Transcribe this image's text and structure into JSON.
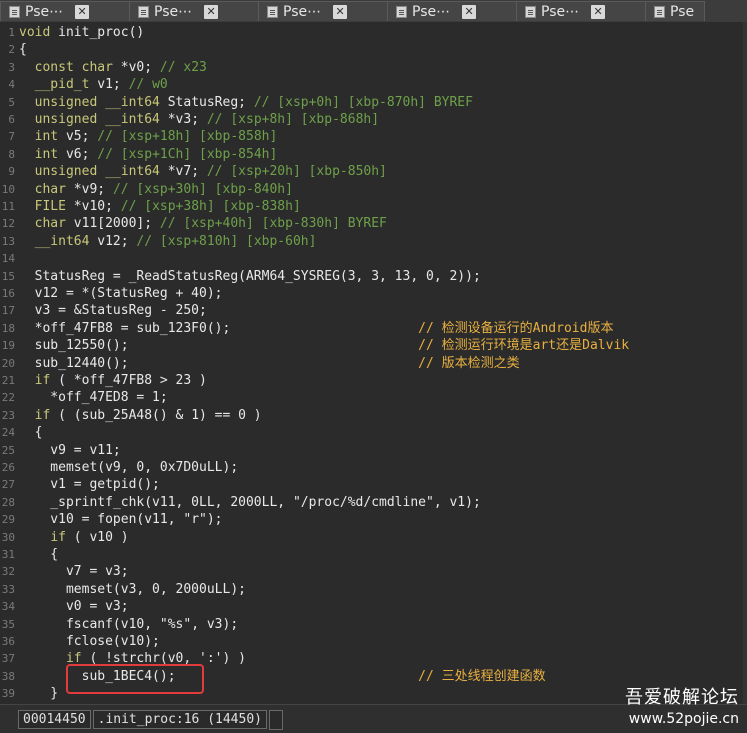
{
  "tabs": [
    {
      "label": "Pse⋯"
    },
    {
      "label": "Pse⋯"
    },
    {
      "label": "Pse⋯"
    },
    {
      "label": "Pse⋯"
    },
    {
      "label": "Pse⋯"
    },
    {
      "label": "Pse"
    }
  ],
  "code_lines": [
    {
      "n": "1",
      "segs": [
        [
          "kw",
          "void "
        ],
        [
          "fn",
          "init_proc()"
        ]
      ]
    },
    {
      "n": "2",
      "segs": [
        [
          "",
          "{"
        ]
      ]
    },
    {
      "n": "3",
      "segs": [
        [
          "",
          "  "
        ],
        [
          "kw",
          "const char "
        ],
        [
          "",
          "*v0; "
        ],
        [
          "cm",
          "// x23"
        ]
      ]
    },
    {
      "n": "4",
      "segs": [
        [
          "",
          "  "
        ],
        [
          "kw",
          "__pid_t "
        ],
        [
          "",
          "v1; "
        ],
        [
          "cm",
          "// w0"
        ]
      ]
    },
    {
      "n": "5",
      "segs": [
        [
          "",
          "  "
        ],
        [
          "kw",
          "unsigned __int64 "
        ],
        [
          "",
          "StatusReg; "
        ],
        [
          "cm",
          "// [xsp+0h] [xbp-870h] BYREF"
        ]
      ]
    },
    {
      "n": "6",
      "segs": [
        [
          "",
          "  "
        ],
        [
          "kw",
          "unsigned __int64 "
        ],
        [
          "",
          "*v3; "
        ],
        [
          "cm",
          "// [xsp+8h] [xbp-868h]"
        ]
      ]
    },
    {
      "n": "7",
      "segs": [
        [
          "",
          "  "
        ],
        [
          "kw",
          "int "
        ],
        [
          "",
          "v5; "
        ],
        [
          "cm",
          "// [xsp+18h] [xbp-858h]"
        ]
      ]
    },
    {
      "n": "8",
      "segs": [
        [
          "",
          "  "
        ],
        [
          "kw",
          "int "
        ],
        [
          "",
          "v6; "
        ],
        [
          "cm",
          "// [xsp+1Ch] [xbp-854h]"
        ]
      ]
    },
    {
      "n": "9",
      "segs": [
        [
          "",
          "  "
        ],
        [
          "kw",
          "unsigned __int64 "
        ],
        [
          "",
          "*v7; "
        ],
        [
          "cm",
          "// [xsp+20h] [xbp-850h]"
        ]
      ]
    },
    {
      "n": "10",
      "segs": [
        [
          "",
          "  "
        ],
        [
          "kw",
          "char "
        ],
        [
          "",
          "*v9; "
        ],
        [
          "cm",
          "// [xsp+30h] [xbp-840h]"
        ]
      ]
    },
    {
      "n": "11",
      "segs": [
        [
          "",
          "  "
        ],
        [
          "kw",
          "FILE "
        ],
        [
          "",
          "*v10; "
        ],
        [
          "cm",
          "// [xsp+38h] [xbp-838h]"
        ]
      ]
    },
    {
      "n": "12",
      "segs": [
        [
          "",
          "  "
        ],
        [
          "kw",
          "char "
        ],
        [
          "",
          "v11[2000]; "
        ],
        [
          "cm",
          "// [xsp+40h] [xbp-830h] BYREF"
        ]
      ]
    },
    {
      "n": "13",
      "segs": [
        [
          "",
          "  "
        ],
        [
          "kw",
          "__int64 "
        ],
        [
          "",
          "v12; "
        ],
        [
          "cm",
          "// [xsp+810h] [xbp-60h]"
        ]
      ]
    },
    {
      "n": "14",
      "segs": [
        [
          "",
          ""
        ]
      ]
    },
    {
      "n": "15",
      "segs": [
        [
          "",
          "  StatusReg = _ReadStatusReg(ARM64_SYSREG(3, 3, 13, 0, 2));"
        ]
      ]
    },
    {
      "n": "16",
      "segs": [
        [
          "",
          "  v12 = *(StatusReg + 40);"
        ]
      ]
    },
    {
      "n": "17",
      "segs": [
        [
          "",
          "  v3 = &StatusReg - 250;"
        ]
      ]
    },
    {
      "n": "18",
      "segs": [
        [
          "",
          "  *off_47FB8 = sub_123F0();                        "
        ],
        [
          "ann",
          "// 检测设备运行的Android版本"
        ]
      ]
    },
    {
      "n": "19",
      "segs": [
        [
          "",
          "  sub_12550();                                     "
        ],
        [
          "ann",
          "// 检测运行环境是art还是Dalvik"
        ]
      ]
    },
    {
      "n": "20",
      "segs": [
        [
          "",
          "  sub_12440();                                     "
        ],
        [
          "ann",
          "// 版本检测之类"
        ]
      ]
    },
    {
      "n": "21",
      "segs": [
        [
          "",
          "  "
        ],
        [
          "kw",
          "if "
        ],
        [
          "",
          "( *off_47FB8 > 23 )"
        ]
      ]
    },
    {
      "n": "22",
      "segs": [
        [
          "",
          "    *off_47ED8 = 1;"
        ]
      ]
    },
    {
      "n": "23",
      "segs": [
        [
          "",
          "  "
        ],
        [
          "kw",
          "if "
        ],
        [
          "",
          "( (sub_25A48() & 1) == 0 )"
        ]
      ]
    },
    {
      "n": "24",
      "segs": [
        [
          "",
          "  {"
        ]
      ]
    },
    {
      "n": "25",
      "segs": [
        [
          "",
          "    v9 = v11;"
        ]
      ]
    },
    {
      "n": "26",
      "segs": [
        [
          "",
          "    memset(v9, 0, 0x7D0uLL);"
        ]
      ]
    },
    {
      "n": "27",
      "segs": [
        [
          "",
          "    v1 = getpid();"
        ]
      ]
    },
    {
      "n": "28",
      "segs": [
        [
          "",
          "    _sprintf_chk(v11, 0LL, 2000LL, "
        ],
        [
          "str",
          "\"/proc/%d/cmdline\""
        ],
        [
          "",
          ", v1);"
        ]
      ]
    },
    {
      "n": "29",
      "segs": [
        [
          "",
          "    v10 = fopen(v11, "
        ],
        [
          "str",
          "\"r\""
        ],
        [
          "",
          ");"
        ]
      ]
    },
    {
      "n": "30",
      "segs": [
        [
          "",
          "    "
        ],
        [
          "kw",
          "if "
        ],
        [
          "",
          "( v10 )"
        ]
      ]
    },
    {
      "n": "31",
      "segs": [
        [
          "",
          "    {"
        ]
      ]
    },
    {
      "n": "32",
      "segs": [
        [
          "",
          "      v7 = v3;"
        ]
      ]
    },
    {
      "n": "33",
      "segs": [
        [
          "",
          "      memset(v3, 0, 2000uLL);"
        ]
      ]
    },
    {
      "n": "34",
      "segs": [
        [
          "",
          "      v0 = v3;"
        ]
      ]
    },
    {
      "n": "35",
      "segs": [
        [
          "",
          "      fscanf(v10, "
        ],
        [
          "str",
          "\"%s\""
        ],
        [
          "",
          ", v3);"
        ]
      ]
    },
    {
      "n": "36",
      "segs": [
        [
          "",
          "      fclose(v10);"
        ]
      ]
    },
    {
      "n": "37",
      "segs": [
        [
          "",
          "      "
        ],
        [
          "kw",
          "if "
        ],
        [
          "",
          "( !strchr(v0, ':') )"
        ]
      ]
    },
    {
      "n": "38",
      "segs": [
        [
          "",
          "        sub_1BEC4();                               "
        ],
        [
          "ann",
          "// 三处线程创建函数"
        ]
      ]
    },
    {
      "n": "39",
      "segs": [
        [
          "",
          "    }"
        ]
      ]
    }
  ],
  "statusbar": {
    "address": "00014450",
    "location": ".init_proc:16 (14450)"
  },
  "watermark": {
    "cn": "吾爱破解论坛",
    "url": "www.52pojie.cn"
  },
  "colors": {
    "background": "#2b2b2b",
    "keyword": "#c8c87a",
    "comment": "#6ea04a",
    "annotation": "#e8b040",
    "highlight_box": "#e23b3b"
  }
}
